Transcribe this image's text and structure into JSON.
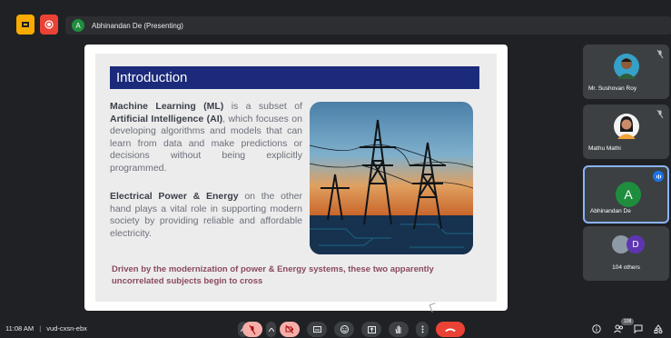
{
  "topbar": {
    "presenter_initial": "A",
    "presenter_label": "Abhinandan De (Presenting)"
  },
  "slide": {
    "title": "Introduction",
    "para1": {
      "t1": "Machine Learning (ML)",
      "t2": " is a subset of ",
      "t3": "Artificial Intelligence (AI)",
      "t4": ", which focuses on developing algorithms and models that can learn from data and make predictions or decisions without being explicitly programmed."
    },
    "para2": {
      "t1": "Electrical Power & Energy",
      "t2": " on the other hand plays a vital role in supporting modern society by providing reliable and affordable electricity."
    },
    "footer": "Driven by the modernization of power & Energy systems, these two apparently uncorrelated subjects begin to cross"
  },
  "participants": [
    {
      "name": "Mr. Sushovan Roy"
    },
    {
      "name": "Mathu Mathi"
    },
    {
      "name": "Abhinandan De",
      "initial": "A"
    },
    {
      "others_initial": "D",
      "label": "104 others"
    }
  ],
  "bottombar": {
    "time": "11:08 AM",
    "separator": "|",
    "meeting_code": "vud-cxsn-ebx",
    "participant_count": "108"
  },
  "colors": {
    "background": "#202124",
    "title_bar": "#1b2a7a",
    "end_call": "#ea4335",
    "accent": "#8ab4f8"
  }
}
